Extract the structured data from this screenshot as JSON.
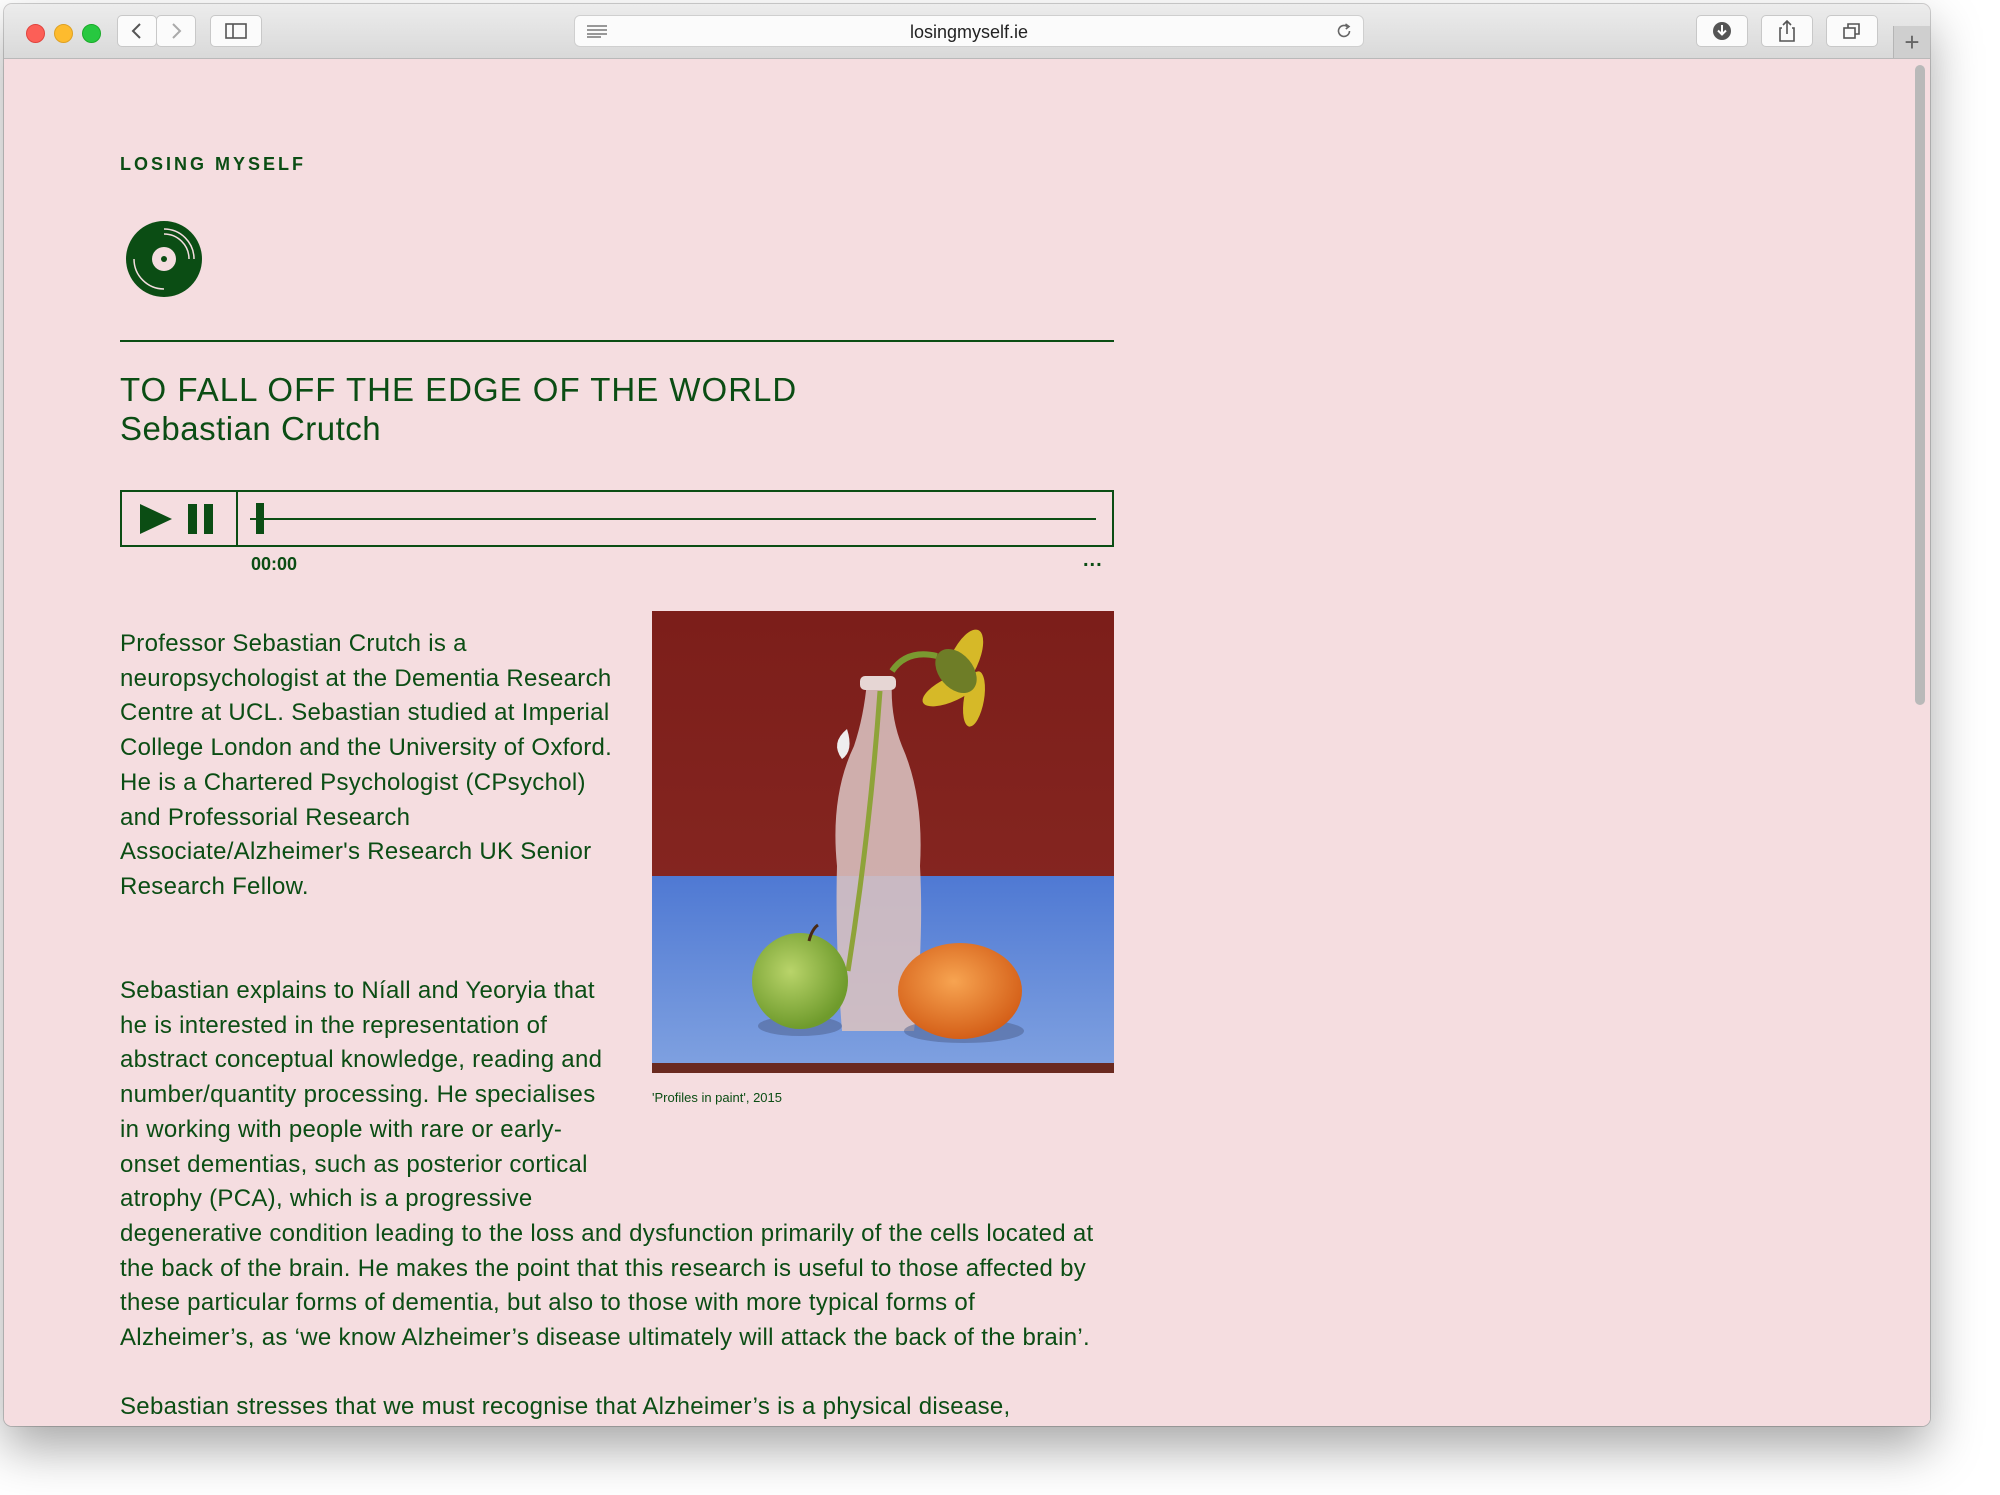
{
  "browser": {
    "url": "losingmyself.ie",
    "new_tab_label": "+"
  },
  "site": {
    "title": "LOSING MYSELF",
    "logo_icon": "vinyl-record-icon",
    "accent_color": "#0b4d14",
    "background_color": "#f5dde0"
  },
  "episode": {
    "title": "TO FALL OFF THE EDGE OF THE WORLD",
    "author": "Sebastian Crutch"
  },
  "player": {
    "time": "00:00",
    "progress": 0,
    "more_label": "..."
  },
  "figure": {
    "caption": "'Profiles in paint', 2015"
  },
  "body": {
    "p1": "Professor Sebastian Crutch is a neuropsychologist at the Dementia Research Centre at UCL. Sebastian studied at Imperial College London and the University of Oxford. He is a Chartered Psychologist (CPsychol) and Professorial Research Associate/Alzheimer's Research UK Senior Research Fellow.",
    "p2": "Sebastian explains to Níall and Yeoryia that he is interested in the representation of abstract conceptual knowledge, reading and number/quantity processing. He specialises in working with people with rare or early-onset dementias, such as posterior cortical atrophy (PCA), which is a progressive degenerative condition leading to the loss and dysfunction primarily of the cells located at the back of the brain. He makes the point that this research is useful to those affected by these particular forms of dementia, but also to those with more typical forms of Alzheimer’s, as ‘we know Alzheimer’s disease ultimately will attack the back of the brain’.",
    "p3": "Sebastian stresses that we must recognise that Alzheimer’s is a physical disease, attacking the physical tissue of the brain itself. In PCA, this degeneration leads to"
  }
}
